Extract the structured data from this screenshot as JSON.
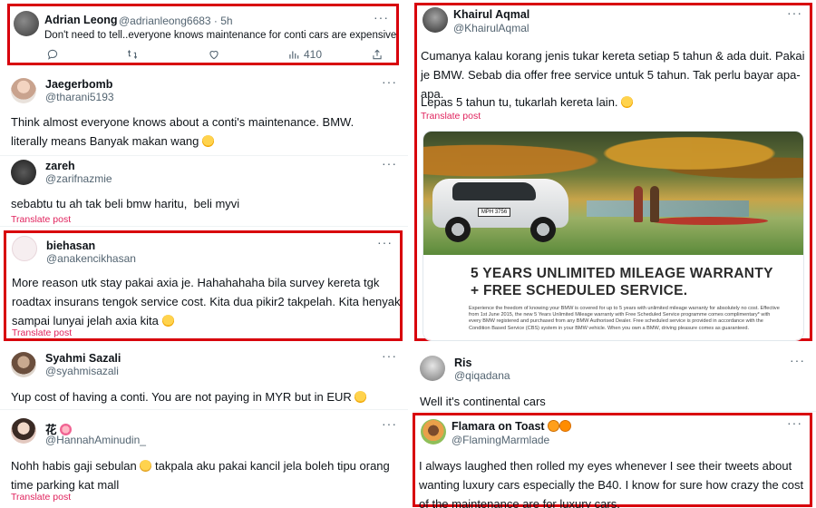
{
  "left": {
    "posts": [
      {
        "name": "Adrian Leong",
        "handle": "@adrianleong6683 · 5h",
        "text": "Don't need to tell..everyone knows maintenance for conti cars are expensive",
        "views": "410"
      },
      {
        "name": "Jaegerbomb",
        "handle": "@tharani5193",
        "text": "Think almost everyone knows about a conti's maintenance. BMW. literally means Banyak makan wang"
      },
      {
        "name": "zareh",
        "handle": "@zarifnazmie",
        "text": "sebabtu tu ah tak beli bmw haritu,  beli myvi",
        "translate": "Translate post"
      },
      {
        "name": "biehasan",
        "handle": "@anakencikhasan",
        "text": "More reason utk stay pakai axia je. Hahahahaha bila survey kereta tgk roadtax insurans tengok service cost. Kita dua pikir2 takpelah. Kita henyak sampai lunyai jelah axia kita",
        "translate": "Translate post"
      },
      {
        "name": "Syahmi Sazali",
        "handle": "@syahmisazali",
        "text": "Yup cost of having a conti. You are not paying in MYR but in EUR"
      },
      {
        "name": "花",
        "handle": "@HannahAminudin_",
        "text": "Nohh habis gaji sebulan",
        "text2": "takpala aku pakai kancil jela boleh tipu orang time parking kat mall",
        "translate": "Translate post"
      }
    ]
  },
  "right": {
    "posts": [
      {
        "name": "Khairul Aqmal",
        "handle": "@KhairulAqmal",
        "text": "Cumanya kalau korang jenis tukar kereta setiap 5 tahun & ada duit. Pakai je BMW. Sebab dia offer free service untuk 5 tahun. Tak perlu bayar apa-apa.",
        "text2": "Lepas 5 tahun tu, tukarlah kereta lain.",
        "translate": "Translate post",
        "ad": {
          "plate": "MPH 3756",
          "headline1": "5 YEARS UNLIMITED MILEAGE WARRANTY",
          "headline2": "+ FREE SCHEDULED SERVICE.",
          "fine": "Experience the freedom of knowing your BMW is covered for up to 5 years with unlimited mileage warranty for absolutely no cost. Effective from 1st June 2015, the new 5 Years Unlimited Mileage warranty with Free Scheduled Service programme comes complimentary* with every BMW registered and purchased from any BMW Authorised Dealer. Free scheduled service is provided in accordance with the Condition Based Service (CBS) system in your BMW vehicle. When you own a BMW, driving pleasure comes as guaranteed."
        }
      },
      {
        "name": "Ris",
        "handle": "@qiqadana",
        "text": "Well it's continental cars"
      },
      {
        "name": "Flamara on Toast",
        "handle": "@FlamingMarmlade",
        "text": "I always laughed then rolled my eyes whenever I see their tweets about wanting luxury cars especially the B40. I know for sure how crazy the cost of the maintenance are for luxury cars."
      }
    ]
  },
  "icons": [
    "reply-icon",
    "retweet-icon",
    "like-icon",
    "views-icon",
    "share-icon",
    "more-icon"
  ],
  "colors": {
    "highlight": "#d8000c",
    "translate": "#e0245e",
    "secondary": "#536471"
  }
}
